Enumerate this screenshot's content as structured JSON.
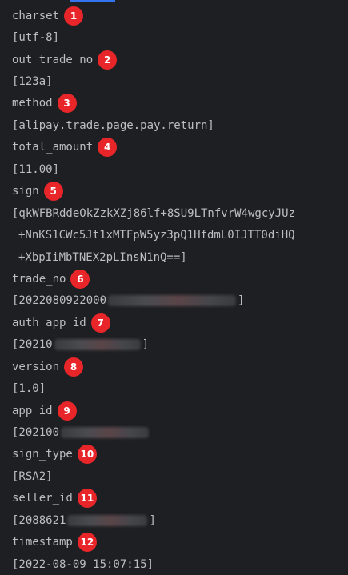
{
  "console": {
    "charset": {
      "key": "charset",
      "value": "[utf-8]",
      "badge": "1"
    },
    "out_trade_no": {
      "key": "out_trade_no",
      "value": "[123a]",
      "badge": "2"
    },
    "method": {
      "key": "method",
      "value": "[alipay.trade.page.pay.return]",
      "badge": "3"
    },
    "total_amount": {
      "key": "total_amount",
      "value": "[11.00]",
      "badge": "4"
    },
    "sign": {
      "key": "sign",
      "badge": "5",
      "value_lines": [
        "[qkWFBRddeOkZzkXZj86lf+8SU9LTnfvrW4wgcyJUz",
        "+NnKS1CWc5Jt1xMTFpW5yz3pQ1HfdmL0IJTT0diHQ",
        "+XbpIiMbTNEX2pLInsN1nQ==]"
      ]
    },
    "trade_no": {
      "key": "trade_no",
      "value_prefix": "[2022080922000",
      "value_suffix": "]",
      "badge": "6"
    },
    "auth_app_id": {
      "key": "auth_app_id",
      "value_prefix": "[20210",
      "value_suffix": "]",
      "badge": "7"
    },
    "version": {
      "key": "version",
      "value": "[1.0]",
      "badge": "8"
    },
    "app_id": {
      "key": "app_id",
      "value_prefix": "[202100",
      "value_suffix": "",
      "badge": "9"
    },
    "sign_type": {
      "key": "sign_type",
      "value": "[RSA2]",
      "badge": "10"
    },
    "seller_id": {
      "key": "seller_id",
      "value_prefix": "[2088621",
      "value_suffix": "]",
      "badge": "11"
    },
    "timestamp": {
      "key": "timestamp",
      "value": "[2022-08-09 15:07:15]",
      "badge": "12"
    }
  },
  "colors": {
    "background": "#1e1f22",
    "text": "#bcbec4",
    "badge": "#e8262a",
    "accent": "#3574f0"
  }
}
